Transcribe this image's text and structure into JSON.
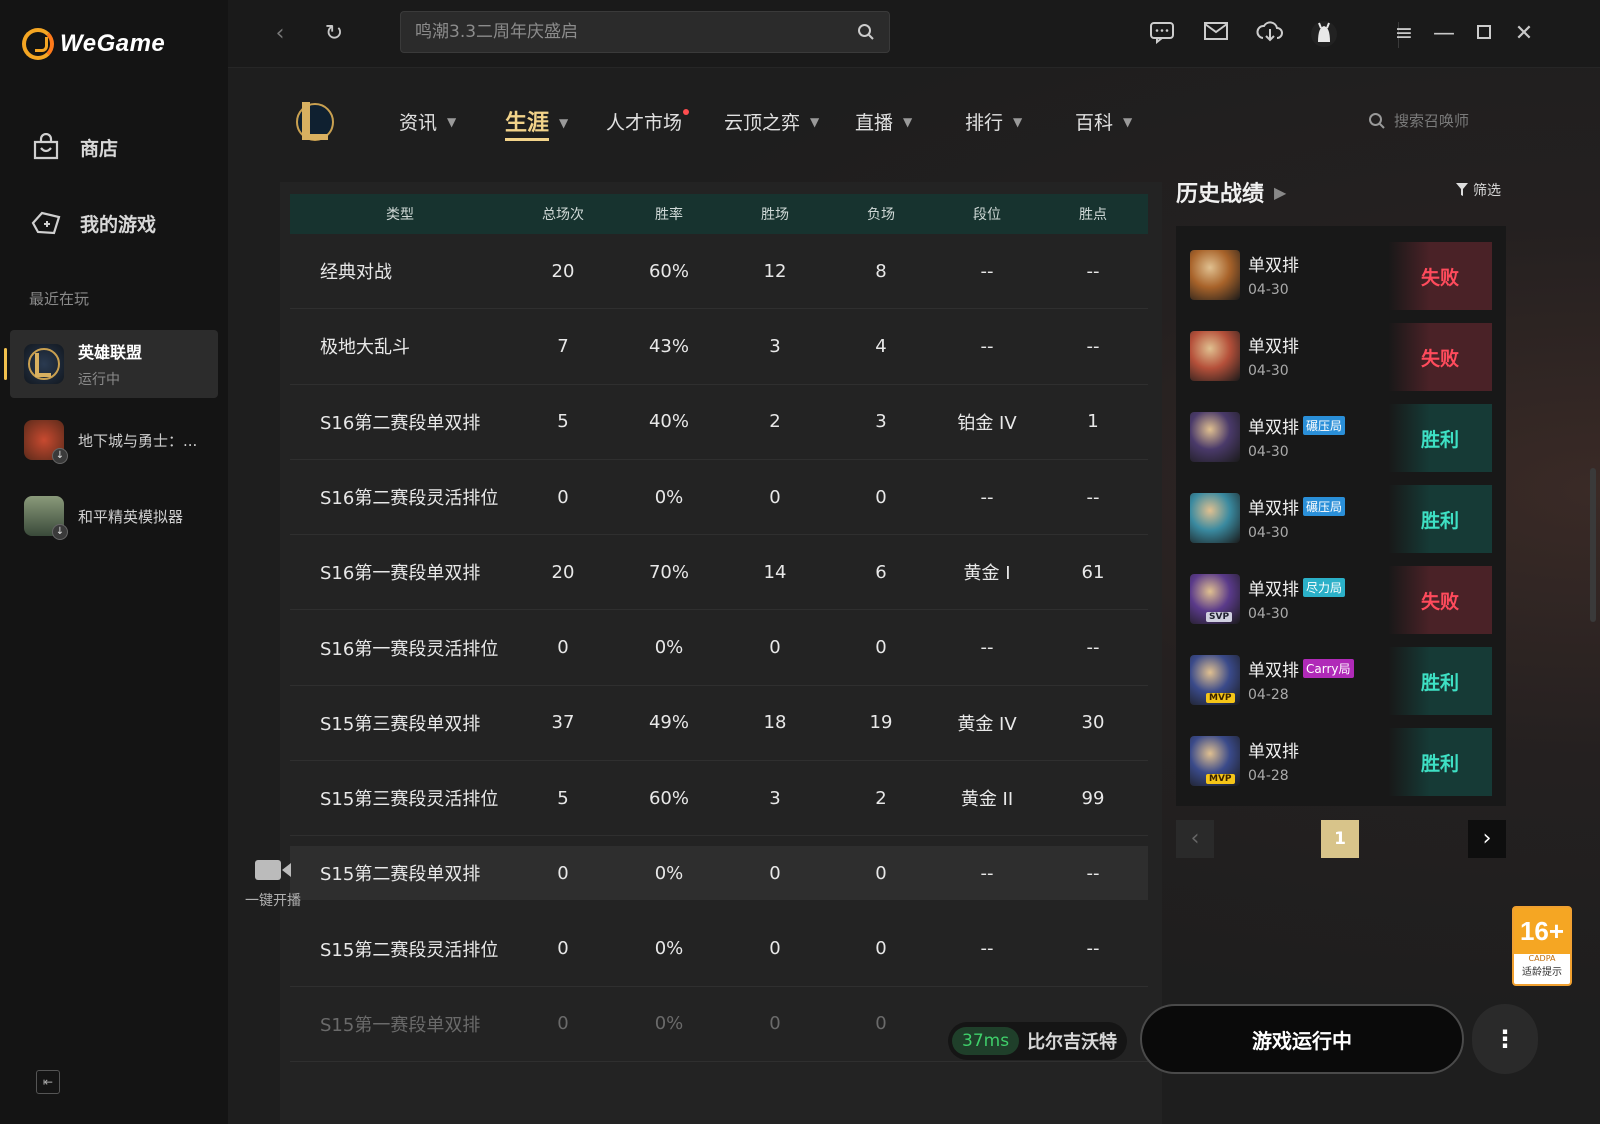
{
  "app": {
    "brand": "WeGame"
  },
  "sidebar": {
    "nav": [
      {
        "label": "商店",
        "icon": "store-icon"
      },
      {
        "label": "我的游戏",
        "icon": "my-games-icon"
      }
    ],
    "recent_label": "最近在玩",
    "games": [
      {
        "name": "英雄联盟",
        "status": "运行中",
        "active": true
      },
      {
        "name": "地下城与勇士：...",
        "status": ""
      },
      {
        "name": "和平精英模拟器",
        "status": ""
      }
    ]
  },
  "topbar": {
    "search_placeholder": "鸣潮3.3二周年庆盛启"
  },
  "game_nav": {
    "tabs": [
      {
        "label": "资讯",
        "caret": true
      },
      {
        "label": "生涯",
        "caret": true,
        "active": true
      },
      {
        "label": "人才市场",
        "dot": true
      },
      {
        "label": "云顶之弈",
        "caret": true
      },
      {
        "label": "直播",
        "caret": true
      },
      {
        "label": "排行",
        "caret": true
      },
      {
        "label": "百科",
        "caret": true
      }
    ],
    "summoner_search_placeholder": "搜索召唤师"
  },
  "stats_table": {
    "columns": [
      "类型",
      "总场次",
      "胜率",
      "胜场",
      "负场",
      "段位",
      "胜点"
    ],
    "rows": [
      [
        "经典对战",
        "20",
        "60%",
        "12",
        "8",
        "--",
        "--"
      ],
      [
        "极地大乱斗",
        "7",
        "43%",
        "3",
        "4",
        "--",
        "--"
      ],
      [
        "S16第二赛段单双排",
        "5",
        "40%",
        "2",
        "3",
        "铂金 IV",
        "1"
      ],
      [
        "S16第二赛段灵活排位",
        "0",
        "0%",
        "0",
        "0",
        "--",
        "--"
      ],
      [
        "S16第一赛段单双排",
        "20",
        "70%",
        "14",
        "6",
        "黄金 I",
        "61"
      ],
      [
        "S16第一赛段灵活排位",
        "0",
        "0%",
        "0",
        "0",
        "--",
        "--"
      ],
      [
        "S15第三赛段单双排",
        "37",
        "49%",
        "18",
        "19",
        "黄金 IV",
        "30"
      ],
      [
        "S15第三赛段灵活排位",
        "5",
        "60%",
        "3",
        "2",
        "黄金 II",
        "99"
      ],
      [
        "S15第二赛段单双排",
        "0",
        "0%",
        "0",
        "0",
        "--",
        "--"
      ],
      [
        "S15第二赛段灵活排位",
        "0",
        "0%",
        "0",
        "0",
        "--",
        "--"
      ],
      [
        "S15第一赛段单双排",
        "0",
        "0%",
        "0",
        "0",
        "--",
        "--"
      ]
    ]
  },
  "live_button": {
    "label": "一键开播"
  },
  "history": {
    "title": "历史战绩",
    "filter_label": "筛选",
    "matches": [
      {
        "mode": "单双排",
        "date": "04-30",
        "result": "失败",
        "win": false,
        "tag": "",
        "badge": "",
        "champ_color": "#a8632a"
      },
      {
        "mode": "单双排",
        "date": "04-30",
        "result": "失败",
        "win": false,
        "tag": "",
        "badge": "",
        "champ_color": "#b5503a"
      },
      {
        "mode": "单双排",
        "date": "04-30",
        "result": "胜利",
        "win": true,
        "tag": "碾压局",
        "tag_color": "#2a8fd8",
        "badge": "",
        "champ_color": "#4a3a6a"
      },
      {
        "mode": "单双排",
        "date": "04-30",
        "result": "胜利",
        "win": true,
        "tag": "碾压局",
        "tag_color": "#2a8fd8",
        "badge": "",
        "champ_color": "#3a8aa0"
      },
      {
        "mode": "单双排",
        "date": "04-30",
        "result": "失败",
        "win": false,
        "tag": "尽力局",
        "tag_color": "#2bb0c8",
        "badge": "SVP",
        "champ_color": "#5a3a8a"
      },
      {
        "mode": "单双排",
        "date": "04-28",
        "result": "胜利",
        "win": true,
        "tag": "Carry局",
        "tag_color": "#b02ab8",
        "badge": "MVP",
        "champ_color": "#3a4a8a"
      },
      {
        "mode": "单双排",
        "date": "04-28",
        "result": "胜利",
        "win": true,
        "tag": "",
        "badge": "MVP",
        "champ_color": "#3a4a8a"
      }
    ],
    "page": "1"
  },
  "age_rating": {
    "age": "16+",
    "org": "CADPA",
    "note": "适龄提示"
  },
  "status": {
    "ping": "37ms",
    "server": "比尔吉沃特",
    "run_label": "游戏运行中",
    "more": "⋮"
  },
  "colors": {
    "accent": "#f2d38a",
    "win": "#3ee0c4",
    "lose": "#ff4b5c",
    "table_header": "#17332f"
  }
}
